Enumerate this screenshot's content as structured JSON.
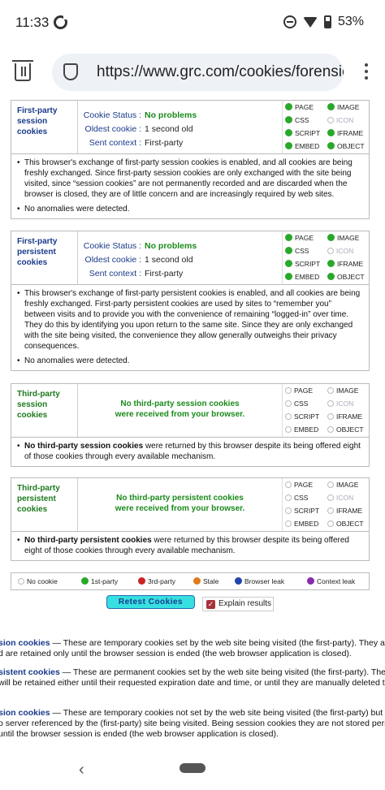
{
  "status_bar": {
    "time": "11:33",
    "battery": "53%"
  },
  "browser": {
    "url": "https://www.grc.com/cookies/forensics"
  },
  "labels": {
    "cookie_status": "Cookie Status :",
    "oldest_cookie": "Oldest cookie :",
    "sent_context": "Sent context :",
    "page": "PAGE",
    "image": "IMAGE",
    "css": "CSS",
    "icon": "ICON",
    "script": "SCRIPT",
    "iframe": "IFRAME",
    "embed": "EMBED",
    "object": "OBJECT"
  },
  "panels": [
    {
      "title": [
        "First-party",
        "session",
        "cookies"
      ],
      "status": "No problems",
      "oldest": "1 second old",
      "context": "First-party",
      "bullets": [
        "This browser's exchange of first-party session cookies is enabled, and all cookies are being freshly exchanged. Since first-party session cookies are only exchanged with the site being visited, since “session cookies” are not permanently recorded and are discarded when the browser is closed, they are of little concern and are increasingly required by web sites.",
        "No anomalies were detected."
      ]
    },
    {
      "title": [
        "First-party",
        "persistent",
        "cookies"
      ],
      "status": "No problems",
      "oldest": "1 second old",
      "context": "First-party",
      "bullets": [
        "This browser's exchange of first-party persistent cookies is enabled, and all cookies are being freshly exchanged. First-party persistent cookies are used by sites to “remember you” between visits and to provide you with the convenience of remaining “logged-in” over time. They do this by identifying you upon return to the same site. Since they are only exchanged with the site being visited, the convenience they allow generally outweighs their privacy consequences.",
        "No anomalies were detected."
      ]
    },
    {
      "title": [
        "Third-party",
        "session",
        "cookies"
      ],
      "message": [
        "No third-party session cookies",
        "were received from your browser."
      ],
      "bullet_bold": "No third-party session cookies",
      "bullet_rest": "were returned by this browser despite its being offered eight of those cookies through every available mechanism."
    },
    {
      "title": [
        "Third-party",
        "persistent",
        "cookies"
      ],
      "message": [
        "No third-party persistent cookies",
        "were received from your browser."
      ],
      "bullet_bold": "No third-party persistent cookies",
      "bullet_rest": "were returned by this browser despite its being offered eight of those cookies through every available mechanism."
    }
  ],
  "legend": [
    "No cookie",
    "1st-party",
    "3rd-party",
    "Stale",
    "Browser leak",
    "Context leak"
  ],
  "buttons": {
    "retest": "Retest Cookies",
    "explain": "Explain results"
  },
  "explanations": [
    {
      "term": "sion cookies",
      "lines": [
        "— These are temporary cookies set by the web site being visited (the first-party). They are no",
        "d are retained only until the browser session is ended (the web browser application is closed)."
      ]
    },
    {
      "term": "sistent cookies",
      "lines": [
        "— These are permanent cookies set by the web site being visited (the first-party). They are",
        "will be retained either until their requested expiration date and time, or until they are manually deleted th"
      ]
    },
    {
      "term": "sion cookies",
      "lines": [
        "— These are temporary cookies not set by the web site being visited (the first-party) but rath",
        "o server referenced by the (first-party) site being visited. Being session cookies they are not stored perma",
        " until the browser session is ended (the web browser application is closed)."
      ]
    }
  ]
}
